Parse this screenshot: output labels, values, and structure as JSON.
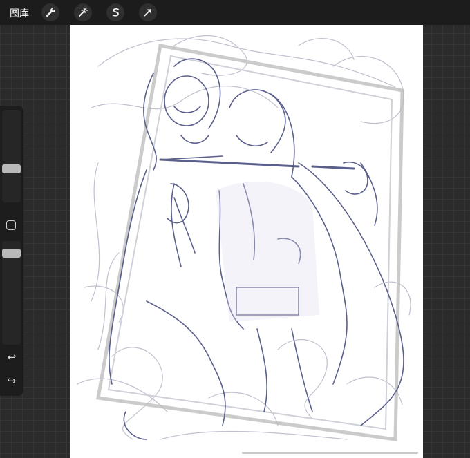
{
  "topbar": {
    "gallery_label": "图库",
    "tools": [
      {
        "name": "actions",
        "icon": "wrench-icon"
      },
      {
        "name": "adjustments",
        "icon": "magic-wand-icon"
      },
      {
        "name": "selection",
        "icon": "selection-s-icon"
      },
      {
        "name": "transform",
        "icon": "arrow-cursor-icon"
      }
    ]
  },
  "sidebar": {
    "brush_size_slider": {
      "icon": "slider-thumb",
      "level": 0.55
    },
    "modify_button_icon": "square-icon",
    "opacity_slider": {
      "icon": "slider-thumb",
      "level": 0.9
    },
    "undo_icon": "undo-arrow-icon",
    "redo_icon": "redo-arrow-icon"
  },
  "canvas": {
    "background_color": "#ffffff",
    "stroke_color": "#5a5f8c",
    "sketch_color": "#b6b8c6"
  },
  "colors": {
    "topbar_bg": "#1c1c1c",
    "workspace_bg": "#2b2b2b",
    "sidebar_bg": "#1d1d1d"
  }
}
